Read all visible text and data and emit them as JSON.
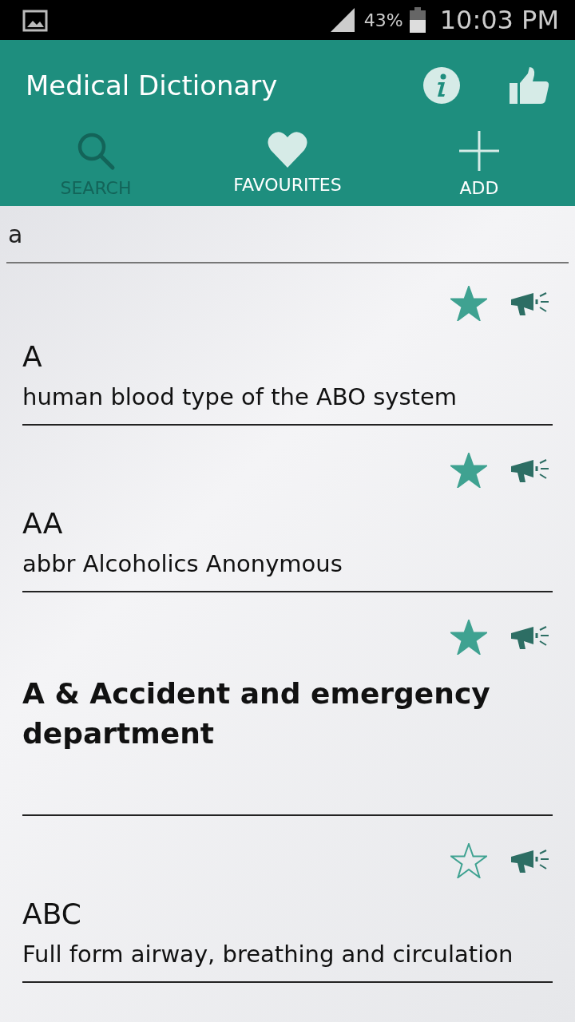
{
  "status_bar": {
    "battery": "43%",
    "time": "10:03 PM"
  },
  "app_bar": {
    "title": "Medical Dictionary"
  },
  "tabs": [
    {
      "label": "SEARCH",
      "kind": "search",
      "selected": true
    },
    {
      "label": "FAVOURITES",
      "kind": "favourites",
      "selected": false
    },
    {
      "label": "ADD",
      "kind": "add",
      "selected": false
    }
  ],
  "search": {
    "value": "a"
  },
  "entries": [
    {
      "term": "A",
      "definition": "human blood type of the ABO system",
      "favourite": true
    },
    {
      "term": "AA",
      "definition": "abbr Alcoholics Anonymous",
      "favourite": true
    },
    {
      "term": "A & Accident and emergency department",
      "favourite": true
    },
    {
      "term": "ABC",
      "definition": "Full form airway, breathing and circulation",
      "favourite": false
    }
  ]
}
